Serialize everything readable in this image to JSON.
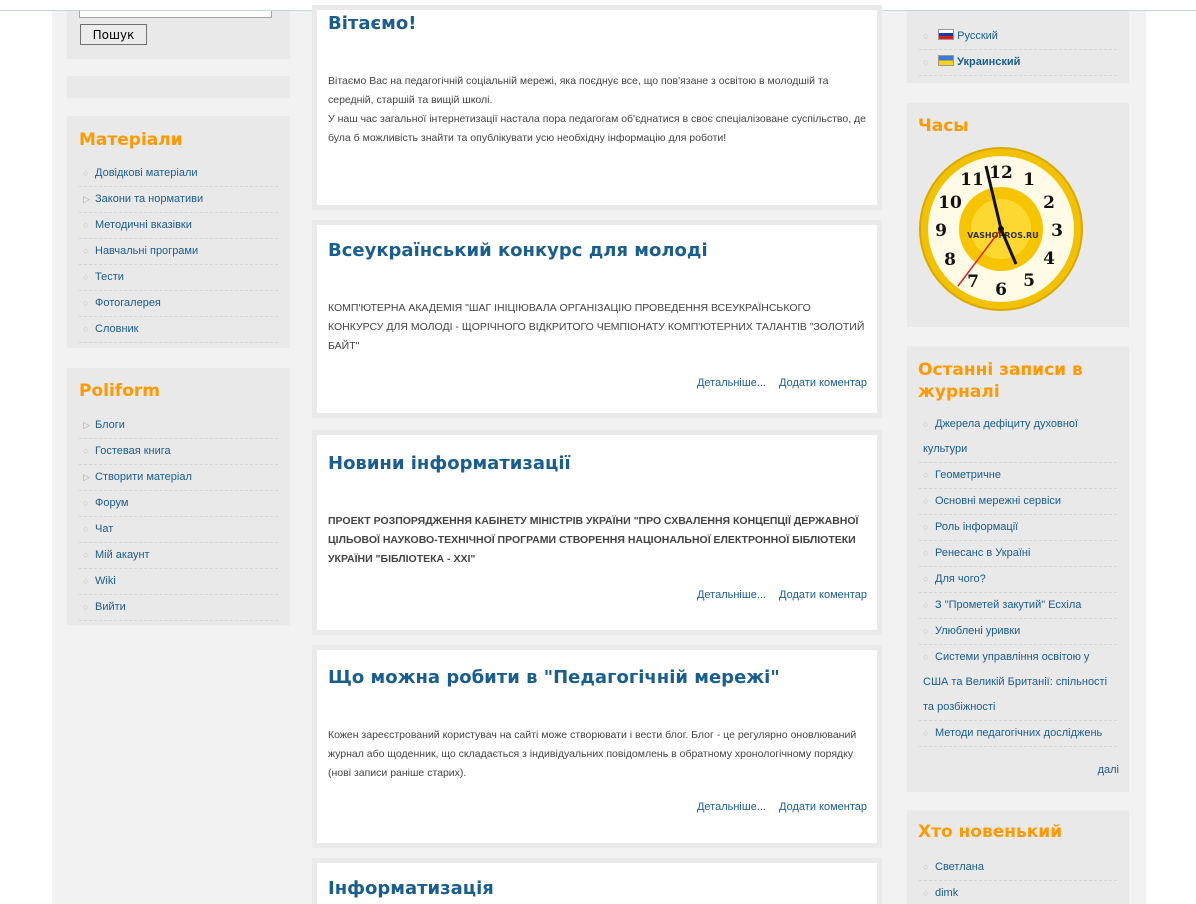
{
  "search": {
    "button_label": "Пошук"
  },
  "materials": {
    "title": "Матеріали",
    "items": [
      {
        "label": "Довідкові матеріали"
      },
      {
        "label": "Закони та нормативи"
      },
      {
        "label": "Методичні вказівки"
      },
      {
        "label": "Навчальні програми"
      },
      {
        "label": "Тести"
      },
      {
        "label": "Фотогалерея"
      },
      {
        "label": "Словник"
      }
    ]
  },
  "poliform": {
    "title": "Poliform",
    "items": [
      {
        "label": "Блоги"
      },
      {
        "label": "Гостевая книга"
      },
      {
        "label": "Створити матеріал"
      },
      {
        "label": "Форум"
      },
      {
        "label": "Чат"
      },
      {
        "label": "Мій акаунт"
      },
      {
        "label": "Wiki"
      },
      {
        "label": "Вийти"
      }
    ]
  },
  "articles": [
    {
      "title": "Вітаємо!",
      "body": "Вітаємо Вас на педагогічній соціальній мережі, яка поєднує все, що пов'язане з освітою в молодшій та середній, старшій та вищій школі.\nУ наш час загальної інтернетизації настала пора педагогам об'єднатися в своє спеціалізоване суспільство, де була б можливість знайти та опублікувати усю необхідну інформацію для роботи!"
    },
    {
      "title": "Всеукраїнський конкурс для молоді",
      "body": "КОМП'ЮТЕРНА АКАДЕМІЯ \"ШАГ ІНІЦІЮВАЛА ОРГАНІЗАЦІЮ ПРОВЕДЕННЯ ВСЕУКРАЇНСЬКОГО КОНКУРСУ ДЛЯ МОЛОДІ - ЩОРІЧНОГО ВІДКРИТОГО ЧЕМПІОНАТУ КОМП'ЮТЕРНИХ ТАЛАНТІВ \"ЗОЛОТИЙ БАЙТ\"",
      "more": "Детальніше...",
      "comment": "Додати коментар"
    },
    {
      "title": "Новини інформатизації",
      "body": "ПРОЕКТ РОЗПОРЯДЖЕННЯ КАБІНЕТУ МІНІСТРІВ УКРАЇНИ \"ПРО СХВАЛЕННЯ КОНЦЕПЦІЇ ДЕРЖАВНОЇ ЦІЛЬОВОЇ НАУКОВО-ТЕХНІЧНОЇ ПРОГРАМИ СТВОРЕННЯ НАЦІОНАЛЬНОЇ ЕЛЕКТРОННОЇ БІБЛІОТЕКИ УКРАЇНИ \"БІБЛІОТЕКА - XXI\"",
      "more": "Детальніше...",
      "comment": "Додати коментар"
    },
    {
      "title": "Що можна робити в \"Педагогічній мережі\"",
      "body": "Кожен зареєстрований користувач на сайті може створювати і вести блог. Блог - це регулярно оновлюваний журнал або щоденник, що складається з індивідуальних повідомлень в обратному хронологічному порядку (нові записи раніше старих).",
      "more": "Детальніше...",
      "comment": "Додати коментар"
    },
    {
      "title": "Інформатизація"
    }
  ],
  "languages": {
    "items": [
      {
        "label": "Русский",
        "flag": "ru-flag-icon"
      },
      {
        "label": "Украинский",
        "flag": "ua-flag-icon"
      }
    ]
  },
  "clock": {
    "title": "Часы",
    "watermark": "VASHOPROS.RU"
  },
  "journal": {
    "title": "Останні записи в журналі",
    "items": [
      {
        "label": "Джерела дефіциту духовної культури"
      },
      {
        "label": "Геометричне"
      },
      {
        "label": "Основні мережні сервіси"
      },
      {
        "label": "Роль інформації"
      },
      {
        "label": "Ренесанс в Україні"
      },
      {
        "label": "Для чого?"
      },
      {
        "label": "З \"Прометей закутий\" Есхіла"
      },
      {
        "label": "Улюблені уривки"
      },
      {
        "label": "Системи управління освітою у США та Великій Британії: спільності та розбіжності"
      },
      {
        "label": "Методи педагогічних досліджень"
      }
    ],
    "more": "далі"
  },
  "newcomers": {
    "title": "Хто новенький",
    "items": [
      {
        "label": "Светлана"
      },
      {
        "label": "dimk"
      }
    ]
  },
  "colors": {
    "accent": "#ff9900",
    "link": "#1a5d8f",
    "box": "#e9e9e9"
  }
}
